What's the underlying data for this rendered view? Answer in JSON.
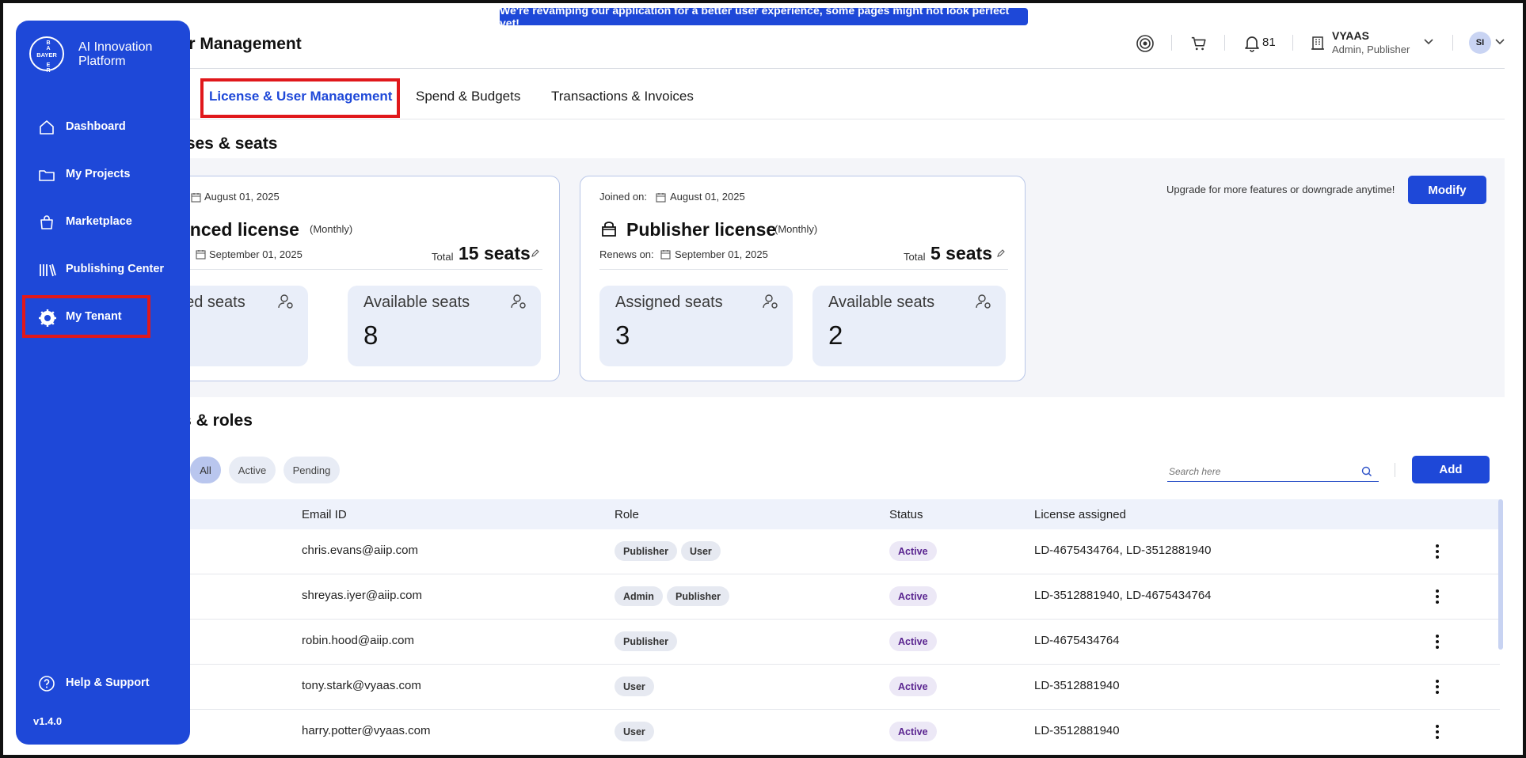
{
  "banner": {
    "text": "We're revamping our application for a better user experience, some pages might not look perfect yet!"
  },
  "header": {
    "title": "ser Management",
    "notification_count": "81",
    "user_name": "VYAAS",
    "user_role": "Admin, Publisher",
    "avatar_initials": "SI"
  },
  "tabs": [
    {
      "label": "License & User Management",
      "active": true
    },
    {
      "label": "Spend & Budgets",
      "active": false
    },
    {
      "label": "Transactions & Invoices",
      "active": false
    }
  ],
  "licenses_section": {
    "title": "nses & seats",
    "upgrade_text": "Upgrade for more features or downgrade anytime!",
    "modify_label": "Modify",
    "cards": [
      {
        "joined_date": "August 01, 2025",
        "title": "anced license",
        "period": "(Monthly)",
        "renews_date": "September 01, 2025",
        "total_label": "Total",
        "total_seats": "15 seats",
        "assigned_label": "ned seats",
        "assigned_value": "",
        "available_label": "Available seats",
        "available_value": "8"
      },
      {
        "joined_label": "Joined on:",
        "joined_date": "August 01, 2025",
        "title": "Publisher license",
        "period": "(Monthly)",
        "renews_label": "Renews on:",
        "renews_date": "September 01, 2025",
        "total_label": "Total",
        "total_seats": "5 seats",
        "assigned_label": "Assigned seats",
        "assigned_value": "3",
        "available_label": "Available seats",
        "available_value": "2"
      }
    ]
  },
  "users_section": {
    "title": "rs & roles",
    "filters": [
      {
        "label": "All",
        "selected": true
      },
      {
        "label": "Active",
        "selected": false
      },
      {
        "label": "Pending",
        "selected": false
      }
    ],
    "search_placeholder": "Search here",
    "add_label": "Add",
    "columns": [
      "Email ID",
      "Role",
      "Status",
      "License assigned"
    ],
    "rows": [
      {
        "email": "chris.evans@aiip.com",
        "roles": [
          "Publisher",
          "User"
        ],
        "status": "Active",
        "license": "LD-4675434764, LD-3512881940"
      },
      {
        "email": "shreyas.iyer@aiip.com",
        "roles": [
          "Admin",
          "Publisher"
        ],
        "status": "Active",
        "license": "LD-3512881940, LD-4675434764"
      },
      {
        "email": "robin.hood@aiip.com",
        "roles": [
          "Publisher"
        ],
        "status": "Active",
        "license": "LD-4675434764"
      },
      {
        "email": "tony.stark@vyaas.com",
        "roles": [
          "User"
        ],
        "status": "Active",
        "license": "LD-3512881940"
      },
      {
        "email": "harry.potter@vyaas.com",
        "roles": [
          "User"
        ],
        "status": "Active",
        "license": "LD-3512881940"
      }
    ]
  },
  "sidebar": {
    "logo_text": "BAYER",
    "platform_name": "AI Innovation Platform",
    "items": [
      {
        "label": "Dashboard",
        "icon": "home-icon"
      },
      {
        "label": "My Projects",
        "icon": "folder-icon"
      },
      {
        "label": "Marketplace",
        "icon": "bag-icon"
      },
      {
        "label": "Publishing Center",
        "icon": "books-icon"
      },
      {
        "label": "My Tenant",
        "icon": "gear-icon"
      }
    ],
    "help_label": "Help & Support",
    "version": "v1.4.0"
  },
  "colors": {
    "primary": "#1e48d8",
    "highlight": "#e0181b",
    "status_text": "#5a2590"
  }
}
